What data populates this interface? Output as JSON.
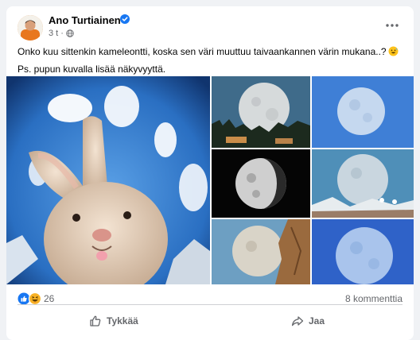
{
  "post": {
    "author": "Ano Turtiainen",
    "time": "3 t",
    "separator": "·",
    "text_line1": "Onko kuu sittenkin kameleontti, koska sen väri muuttuu taivaankannen värin mukana..?",
    "text_line2": "Ps. pupun kuvalla lisää näkyvyyttä.",
    "icons": {
      "verified": "verified-badge-icon",
      "audience": "globe-icon",
      "more": "more-options-icon",
      "emoji": "grinning-sweat-emoji"
    }
  },
  "stats": {
    "reactions_count": "26",
    "comments": "8 kommenttia",
    "reaction_types": [
      "like",
      "haha"
    ]
  },
  "actions": {
    "like_label": "Tykkää",
    "share_label": "Jaa"
  },
  "colors": {
    "brand_blue": "#1877f2",
    "haha_yellow": "#f7b125",
    "secondary_text": "#65676b"
  }
}
